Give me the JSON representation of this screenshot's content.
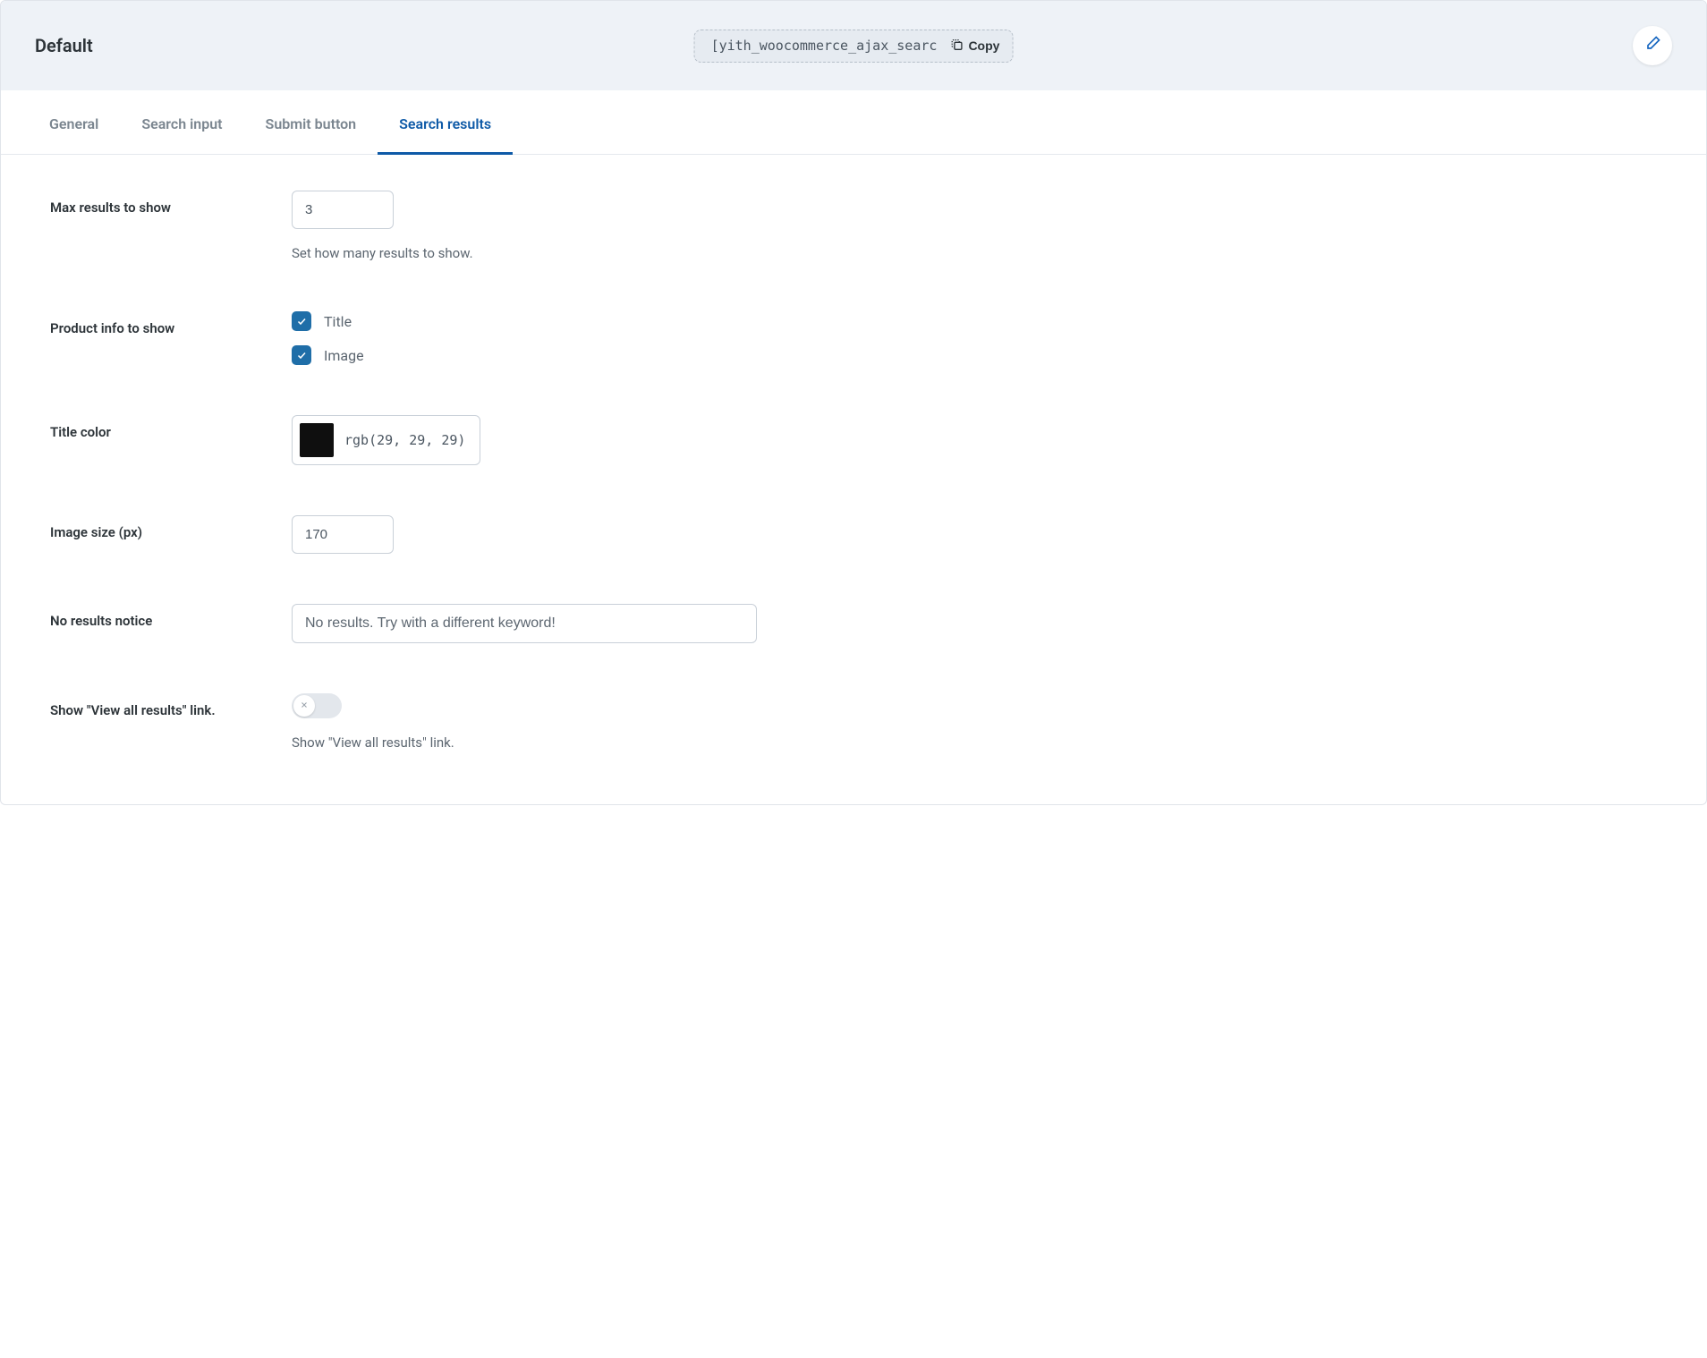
{
  "header": {
    "title": "Default",
    "shortcode": "[yith_woocommerce_ajax_searc",
    "copy_label": "Copy"
  },
  "tabs": [
    {
      "label": "General",
      "active": false
    },
    {
      "label": "Search input",
      "active": false
    },
    {
      "label": "Submit button",
      "active": false
    },
    {
      "label": "Search results",
      "active": true
    }
  ],
  "fields": {
    "max_results": {
      "label": "Max results to show",
      "value": "3",
      "help": "Set how many results to show."
    },
    "product_info": {
      "label": "Product info to show",
      "options": [
        {
          "label": "Title",
          "checked": true
        },
        {
          "label": "Image",
          "checked": true
        }
      ]
    },
    "title_color": {
      "label": "Title color",
      "value": "rgb(29, 29, 29)",
      "swatch": "#1d1d1d"
    },
    "image_size": {
      "label": "Image size (px)",
      "value": "170"
    },
    "no_results": {
      "label": "No results notice",
      "value": "No results. Try with a different keyword!"
    },
    "view_all": {
      "label": "Show \"View all results\" link.",
      "help": "Show \"View all results\" link.",
      "enabled": false
    }
  }
}
